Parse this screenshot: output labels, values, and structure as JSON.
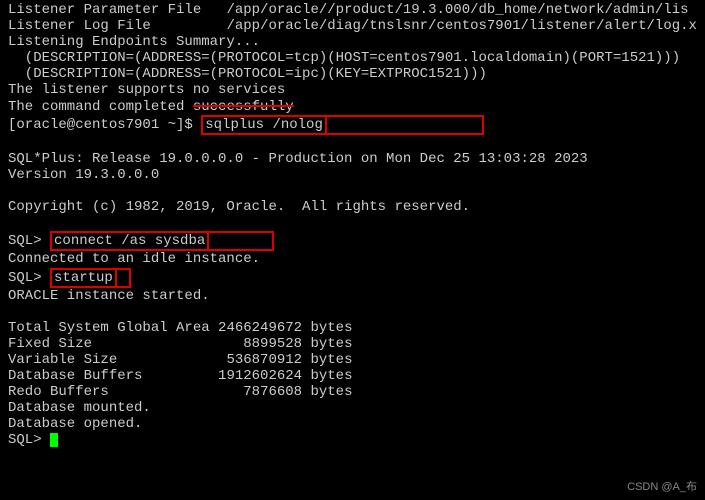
{
  "terminal": {
    "header": {
      "param_file_label": "Listener Parameter File",
      "param_file_path": "/app/oracle//product/19.3.000/db_home/network/admin/lis",
      "log_file_label": "Listener Log File",
      "log_file_path": "/app/oracle/diag/tnslsnr/centos7901/listener/alert/log.x",
      "endpoints_summary": "Listening Endpoints Summary...",
      "desc1": "  (DESCRIPTION=(ADDRESS=(PROTOCOL=tcp)(HOST=centos7901.localdomain)(PORT=1521)))",
      "desc2": "  (DESCRIPTION=(ADDRESS=(PROTOCOL=ipc)(KEY=EXTPROC1521)))",
      "no_services": "The listener supports no services",
      "completed_prefix": "The command completed ",
      "completed_strike": "successfully"
    },
    "prompt1": {
      "shell": "[oracle@centos7901 ~]$ ",
      "cmd": "sqlplus /nolog"
    },
    "sqlplus": {
      "release": "SQL*Plus: Release 19.0.0.0.0 - Production on Mon Dec 25 13:03:28 2023",
      "version": "Version 19.3.0.0.0",
      "copyright": "Copyright (c) 1982, 2019, Oracle.  All rights reserved."
    },
    "sql1": {
      "prompt": "SQL> ",
      "cmd": "connect /as sysdba"
    },
    "connected_msg": "Connected to an idle instance.",
    "sql2": {
      "prompt": "SQL> ",
      "cmd": "startup"
    },
    "started_msg": "ORACLE instance started.",
    "sga": {
      "total_label": "Total System Global Area",
      "total_value": " 2466249672 bytes",
      "fixed_label": "Fixed Size",
      "fixed_value": "    8899528 bytes",
      "variable_label": "Variable Size",
      "variable_value": "  536870912 bytes",
      "buffers_label": "Database Buffers",
      "buffers_value": " 1912602624 bytes",
      "redo_label": "Redo Buffers",
      "redo_value": "    7876608 bytes"
    },
    "mounted": "Database mounted.",
    "opened": "Database opened.",
    "final_prompt": "SQL> "
  },
  "watermark": "CSDN @A_布"
}
